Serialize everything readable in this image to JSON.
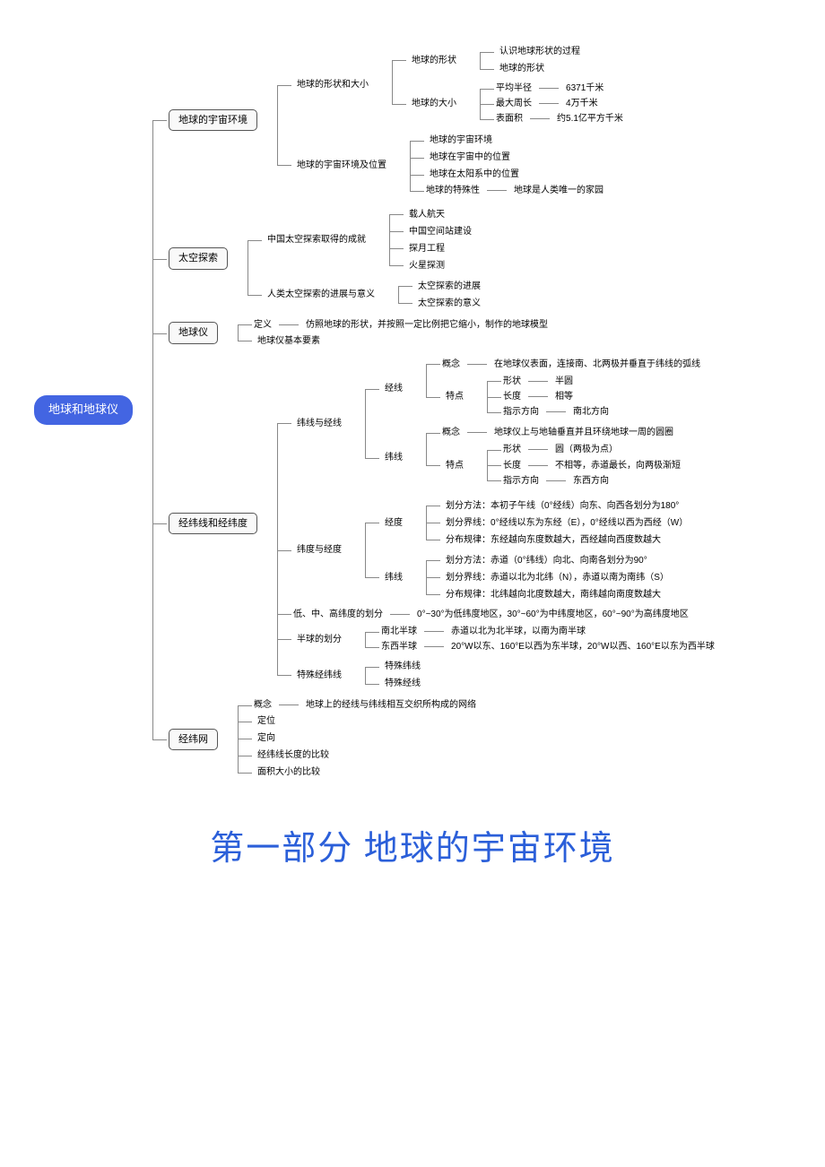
{
  "root": "地球和地球仪",
  "b1": {
    "t": "地球的宇宙环境",
    "c1": {
      "t": "地球的形状和大小",
      "s1": {
        "t": "地球的形状",
        "l1": "认识地球形状的过程",
        "l2": "地球的形状"
      },
      "s2": {
        "t": "地球的大小",
        "r1k": "平均半径",
        "r1v": "6371千米",
        "r2k": "最大周长",
        "r2v": "4万千米",
        "r3k": "表面积",
        "r3v": "约5.1亿平方千米"
      }
    },
    "c2": {
      "t": "地球的宇宙环境及位置",
      "l1": "地球的宇宙环境",
      "l2": "地球在宇宙中的位置",
      "l3": "地球在太阳系中的位置",
      "l4k": "地球的特殊性",
      "l4v": "地球是人类唯一的家园"
    }
  },
  "b2": {
    "t": "太空探索",
    "c1": {
      "t": "中国太空探索取得的成就",
      "l1": "载人航天",
      "l2": "中国空间站建设",
      "l3": "探月工程",
      "l4": "火星探测"
    },
    "c2": {
      "t": "人类太空探索的进展与意义",
      "l1": "太空探索的进展",
      "l2": "太空探索的意义"
    }
  },
  "b3": {
    "t": "地球仪",
    "defk": "定义",
    "defv": "仿照地球的形状，并按照一定比例把它缩小，制作的地球模型",
    "l2": "地球仪基本要素"
  },
  "b4": {
    "t": "经纬线和经纬度",
    "c1": {
      "t": "纬线与经线",
      "jx": {
        "t": "经线",
        "ck": "概念",
        "cv": "在地球仪表面，连接南、北两极并垂直于纬线的弧线",
        "tdt": "特点",
        "shk": "形状",
        "shv": "半圆",
        "lnk": "长度",
        "lnv": "相等",
        "dik": "指示方向",
        "div": "南北方向"
      },
      "wx": {
        "t": "纬线",
        "ck": "概念",
        "cv": "地球仪上与地轴垂直并且环绕地球一周的圆圈",
        "tdt": "特点",
        "shk": "形状",
        "shv": "圆（两极为点）",
        "lnk": "长度",
        "lnv": "不相等，赤道最长，向两极渐短",
        "dik": "指示方向",
        "div": "东西方向"
      }
    },
    "c2": {
      "t": "纬度与经度",
      "jd": {
        "t": "经度",
        "l1": "划分方法：本初子午线（0°经线）向东、向西各划分为180°",
        "l2": "划分界线：0°经线以东为东经（E），0°经线以西为西经（W）",
        "l3": "分布规律：东经越向东度数越大，西经越向西度数越大"
      },
      "wd": {
        "t": "纬线",
        "l1": "划分方法：赤道（0°纬线）向北、向南各划分为90°",
        "l2": "划分界线：赤道以北为北纬（N），赤道以南为南纬（S）",
        "l3": "分布规律：北纬越向北度数越大，南纬越向南度数越大"
      }
    },
    "c3k": "低、中、高纬度的划分",
    "c3v": "0°~30°为低纬度地区，30°~60°为中纬度地区，60°~90°为高纬度地区",
    "c4": {
      "t": "半球的划分",
      "nsk": "南北半球",
      "nsv": "赤道以北为北半球，以南为南半球",
      "ewk": "东西半球",
      "ewv": "20°W以东、160°E以西为东半球，20°W以西、160°E以东为西半球"
    },
    "c5": {
      "t": "特殊经纬线",
      "l1": "特殊纬线",
      "l2": "特殊经线"
    }
  },
  "b5": {
    "t": "经纬网",
    "l1k": "概念",
    "l1v": "地球上的经线与纬线相互交织所构成的网络",
    "l2": "定位",
    "l3": "定向",
    "l4": "经纬线长度的比较",
    "l5": "面积大小的比较"
  },
  "title": "第一部分  地球的宇宙环境"
}
